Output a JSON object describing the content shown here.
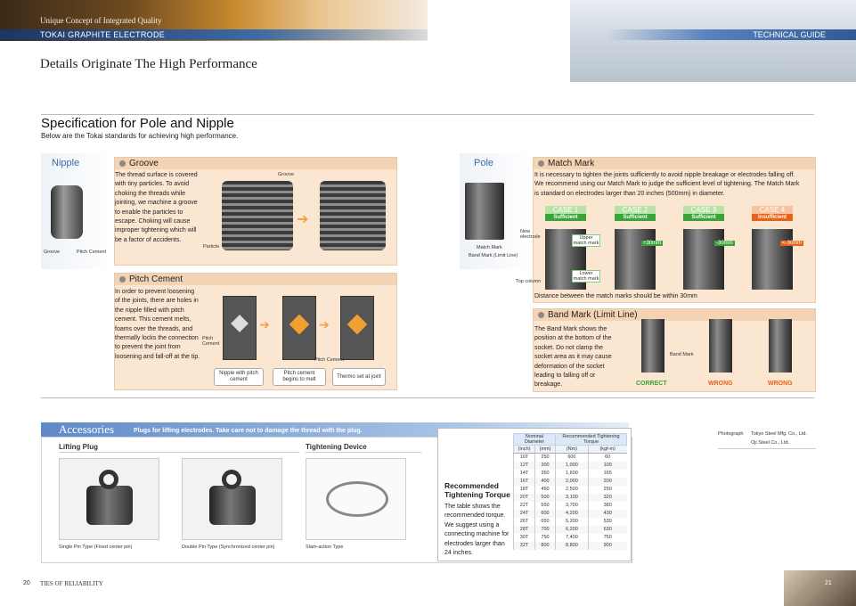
{
  "header": {
    "tagline": "Unique Concept of Integrated Quality",
    "brand": "TOKAI GRAPHITE ELECTRODE",
    "guide": "TECHNICAL GUIDE",
    "title": "Details Originate The High Performance"
  },
  "section": {
    "title": "Specification for Pole and Nipple",
    "subtitle": "Below are the Tokai standards for achieving high performance."
  },
  "nipple": {
    "title": "Nipple",
    "groove_label": "Groove",
    "pitch_label": "Pitch Cement"
  },
  "groove": {
    "heading": "Groove",
    "text": "The thread surface is covered with tiny particles. To avoid choking the threads while jointing, we machine a groove to enable the particles to escape. Choking will cause improper tightening which will be a factor of accidents.",
    "label_groove": "Groove",
    "label_particle": "Particle"
  },
  "pitch": {
    "heading": "Pitch Cement",
    "text": "In order to prevent loosening of the joints, there are holes in the nipple filled with pitch cement. This cement melts, foams over the threads, and thermally locks the connection to prevent the joint from loosening and fall-off at the tip.",
    "label_pitch": "Pitch Cement",
    "label_pitch2": "Pitch Cement",
    "step1": "Nipple with pitch cement",
    "step2": "Pitch cement begins to melt",
    "step3": "Thermo set at joint"
  },
  "pole": {
    "title": "Pole",
    "match_label": "Match Mark",
    "band_label": "Band Mark (Limit Line)"
  },
  "match": {
    "heading": "Match Mark",
    "text": "It is necessary to tighten the joints sufficiently to avoid nipple breakage or electrodes falling off. We recommend using our Match Mark to judge the sufficient level of tightening. The Match Mark is standard on electrodes larger than 20 inches (500mm) in diameter.",
    "new_electrode": "New electrode",
    "upper": "Upper match mark",
    "lower": "Lower match mark",
    "top_column": "Top column",
    "note": "Distance between the match marks should be within 30mm",
    "cases": [
      {
        "t": "CASE 1",
        "s": "Sufficient",
        "tag": ""
      },
      {
        "t": "CASE 2",
        "s": "Sufficient",
        "tag": "+30mm"
      },
      {
        "t": "CASE 3",
        "s": "Sufficient",
        "tag": "-30mm"
      },
      {
        "t": "CASE 4",
        "s": "Insufficient",
        "tag": "<-30mm"
      }
    ]
  },
  "band": {
    "heading": "Band Mark (Limit Line)",
    "text": "The Band Mark shows the position at the bottom of the socket. Do not clamp the socket area as it may cause deformation of the socket leading to falling off or breakage.",
    "band_mark": "Band Mark",
    "correct": "CORRECT",
    "wrong1": "WRONG",
    "wrong2": "WRONG"
  },
  "photo_credit": {
    "label": "Photograph",
    "lines": [
      "Tokyo Steel Mfg. Co., Ltd.",
      "Oji Steel Co., Ltd."
    ]
  },
  "accessories": {
    "title": "Accessories",
    "subtitle": "Plugs for lifting electrodes. Take care not to damage the thread with the plug.",
    "lifting": "Lifting Plug",
    "tightening": "Tightening Device",
    "cap1": "Single Pin Type (Fixed center pin)",
    "cap2": "Double Pin Type (Synchronized center pin)",
    "cap3": "Slam-action Type"
  },
  "torque": {
    "title": "Recommended Tightening Torque",
    "text": "The table shows the recommended torque. We suggest using a connecting machine for electrodes larger than 24 inches.",
    "h_diam": "Nominal Diameter",
    "h_torque": "Recommended Tightening Torque",
    "units": [
      "(inch)",
      "(mm)",
      "(Nm)",
      "(kgf-m)"
    ],
    "rows": [
      [
        "10T",
        "250",
        "600",
        "60"
      ],
      [
        "12T",
        "300",
        "1,000",
        "100"
      ],
      [
        "14T",
        "350",
        "1,600",
        "165"
      ],
      [
        "16T",
        "400",
        "2,000",
        "200"
      ],
      [
        "18T",
        "450",
        "2,500",
        "250"
      ],
      [
        "20T",
        "500",
        "3,100",
        "320"
      ],
      [
        "22T",
        "550",
        "3,700",
        "380"
      ],
      [
        "24T",
        "600",
        "4,200",
        "430"
      ],
      [
        "26T",
        "650",
        "5,200",
        "530"
      ],
      [
        "28T",
        "700",
        "6,200",
        "630"
      ],
      [
        "30T",
        "750",
        "7,400",
        "750"
      ],
      [
        "32T",
        "800",
        "8,800",
        "900"
      ]
    ]
  },
  "footer": {
    "left_num": "20",
    "left_text": "TIES OF RELIABILITY",
    "right_num": "21"
  },
  "colors": {
    "accent_blue": "#3a6aa8",
    "panel": "#fbe6d2",
    "sufficient": "#3aa43a",
    "insufficient": "#e8621a"
  }
}
